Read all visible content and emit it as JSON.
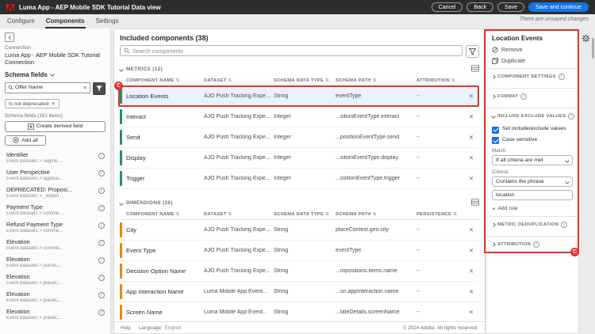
{
  "colors": {
    "accent": "#1473e6",
    "metric": "#268e6c",
    "dimension": "#e68619",
    "annotation": "#e5332b"
  },
  "annotation": {
    "label": "C"
  },
  "icons": {
    "close": "✕",
    "sort": "⇅",
    "info": "i",
    "add": "+"
  },
  "topbar": {
    "app_title": "Luma App - AEP Mobile SDK Tutorial Data view",
    "cancel": "Cancel",
    "back": "Back",
    "save": "Save",
    "save_continue": "Save and continue",
    "unsaved": "There are unsaved changes"
  },
  "tabs": [
    {
      "label": "Configure"
    },
    {
      "label": "Components"
    },
    {
      "label": "Settings"
    }
  ],
  "sidebar": {
    "connection_label": "Connection",
    "connection_name": "Luma App - AEP Mobile SDK Tutorial Connection",
    "fields_selector": "Schema fields",
    "search_value": "Offer Name",
    "filter_chip": "Is not deprecated",
    "fields_count": "Schema fields (161 items)",
    "create_derived": "Create derived field",
    "add_all": "Add all",
    "items": [
      {
        "name": "Identifier",
        "path": "Event datasets > segme..."
      },
      {
        "name": "User Perspective",
        "path": "Event datasets > applica..."
      },
      {
        "name": "DEPRECATED: Proposi...",
        "path": "Event datasets > _experi..."
      },
      {
        "name": "Payment Type",
        "path": "Event datasets > comme..."
      },
      {
        "name": "Refund Payment Type",
        "path": "Event datasets > comme..."
      },
      {
        "name": "Elevation",
        "path": "Event datasets > comme..."
      },
      {
        "name": "Elevation",
        "path": "Event datasets > placeC..."
      },
      {
        "name": "Elevation",
        "path": "Event datasets > placeC..."
      },
      {
        "name": "Elevation",
        "path": "Event datasets > placeC..."
      },
      {
        "name": "Elevation",
        "path": "Event datasets > placeC..."
      }
    ]
  },
  "main": {
    "included_title": "Included components (38)",
    "search_placeholder": "Search components",
    "metrics": {
      "section_label": "METRICS (12)",
      "columns": [
        "COMPONENT NAME",
        "DATASET",
        "SCHEMA DATA TYPE",
        "SCHEMA PATH",
        "ATTRIBUTION"
      ],
      "rows": [
        {
          "name": "Location Events",
          "dataset": "AJO Push Tracking Expe...",
          "type": "String",
          "path": "eventType",
          "end": "--"
        },
        {
          "name": "Interact",
          "dataset": "AJO Push Tracking Expe...",
          "type": "Integer",
          "path": "...sitionEventType.interact",
          "end": "--"
        },
        {
          "name": "Send",
          "dataset": "AJO Push Tracking Expe...",
          "type": "Integer",
          "path": "...positionEventType.send",
          "end": "--"
        },
        {
          "name": "Display",
          "dataset": "AJO Push Tracking Expe...",
          "type": "Integer",
          "path": "...sitionEventType.display",
          "end": "--"
        },
        {
          "name": "Trigger",
          "dataset": "AJO Push Tracking Expe...",
          "type": "Integer",
          "path": "...ositionEventType.trigger",
          "end": "--"
        }
      ]
    },
    "dimensions": {
      "section_label": "DIMENSIONS (26)",
      "columns": [
        "COMPONENT NAME",
        "DATASET",
        "SCHEMA DATA TYPE",
        "SCHEMA PATH",
        "PERSISTENCE"
      ],
      "rows": [
        {
          "name": "City",
          "dataset": "AJO Push Tracking Expe...",
          "type": "String",
          "path": "placeContext.geo.city",
          "end": "--"
        },
        {
          "name": "Event Type",
          "dataset": "AJO Push Tracking Expe...",
          "type": "String",
          "path": "eventType",
          "end": "--"
        },
        {
          "name": "Decision Option Name",
          "dataset": "AJO Push Tracking Expe...",
          "type": "String",
          "path": "...ropositions.items.name",
          "end": "--"
        },
        {
          "name": "App Interaction Name",
          "dataset": "Luma Mobile App Event...",
          "type": "String",
          "path": "...on.appInteraction.name",
          "end": "--"
        },
        {
          "name": "Screen Name",
          "dataset": "Luma Mobile App Event...",
          "type": "String",
          "path": "...tateDetails.screenName",
          "end": "--"
        }
      ]
    },
    "footer": {
      "help": "Help",
      "language_label": "Language:",
      "language": "English",
      "copyright": "© 2024 Adobe. All rights reserved."
    }
  },
  "panel": {
    "title": "Location Events",
    "remove": "Remove",
    "duplicate": "Duplicate",
    "sections": {
      "component_settings": "COMPONENT SETTINGS",
      "format": "FORMAT",
      "include_exclude": "INCLUDE EXCLUDE VALUES",
      "metric_dedup": "METRIC DEDUPLICATION",
      "attribution": "ATTRIBUTION"
    },
    "checkbox_include": "Set include/exclude values",
    "checkbox_case": "Case sensitive",
    "match_label": "Match",
    "match_value": "If all criteria are met",
    "criteria_label": "Criteria",
    "criteria_value": "Contains the phrase",
    "criteria_input": "location",
    "add_rule": "Add rule"
  }
}
